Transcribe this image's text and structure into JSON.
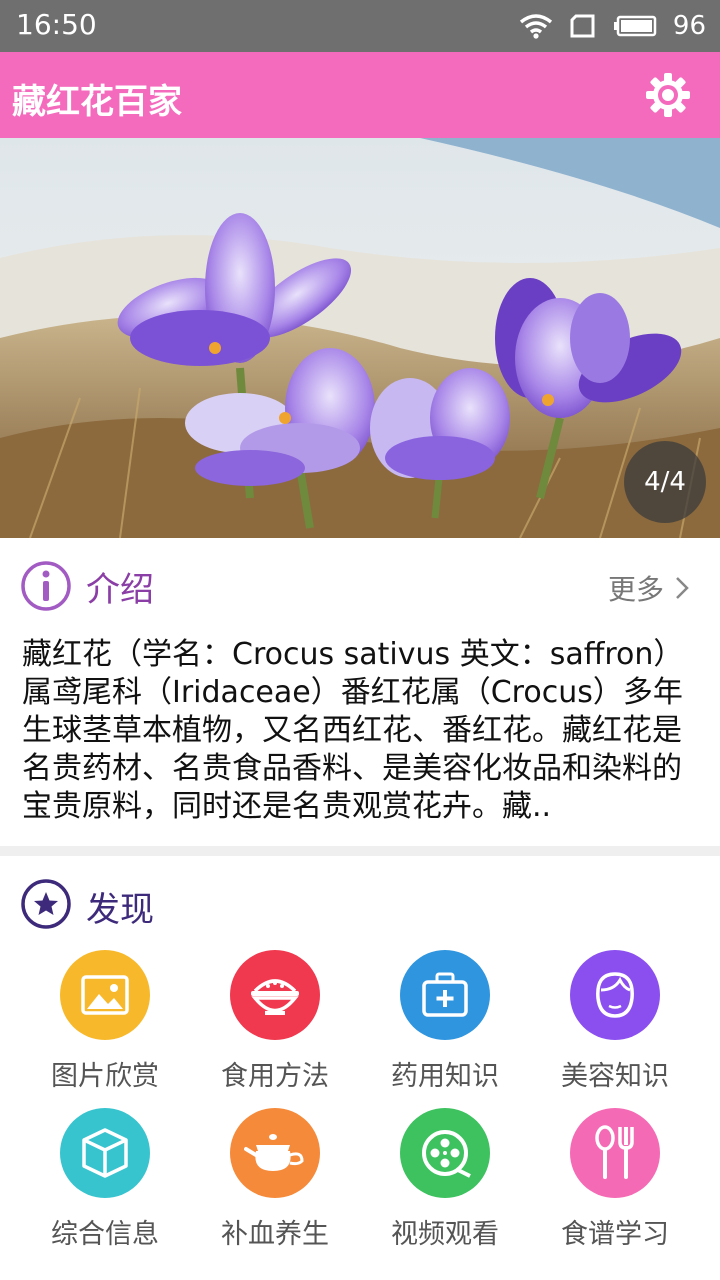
{
  "status": {
    "time": "16:50",
    "battery": "96"
  },
  "app": {
    "title": "藏红花百家"
  },
  "banner": {
    "page_indicator": "4/4"
  },
  "intro": {
    "title": "介绍",
    "more_label": "更多",
    "text": "藏红花（学名：Crocus sativus 英文：saffron）属鸢尾科（Iridaceae）番红花属（Crocus）多年生球茎草本植物，又名西红花、番红花。藏红花是名贵药材、名贵食品香料、是美容化妆品和染料的宝贵原料，同时还是名贵观赏花卉。藏.."
  },
  "discover": {
    "title": "发现",
    "items": [
      {
        "label": "图片欣赏",
        "icon": "image-icon",
        "color": "#f7b92b"
      },
      {
        "label": "食用方法",
        "icon": "bowl-icon",
        "color": "#f0384e"
      },
      {
        "label": "药用知识",
        "icon": "medical-kit-icon",
        "color": "#2f95df"
      },
      {
        "label": "美容知识",
        "icon": "face-icon",
        "color": "#8b4ff0"
      },
      {
        "label": "综合信息",
        "icon": "cube-icon",
        "color": "#38c4cf"
      },
      {
        "label": "补血养生",
        "icon": "teapot-icon",
        "color": "#f58a3a"
      },
      {
        "label": "视频观看",
        "icon": "film-reel-icon",
        "color": "#3dc25f"
      },
      {
        "label": "食谱学习",
        "icon": "spoon-fork-icon",
        "color": "#f56ab4"
      }
    ]
  },
  "colors": {
    "appbar": "#f46bbd",
    "statusbar": "#6f6f6f",
    "intro_accent": "#8a3ea6",
    "discover_accent": "#3d2a7a"
  }
}
